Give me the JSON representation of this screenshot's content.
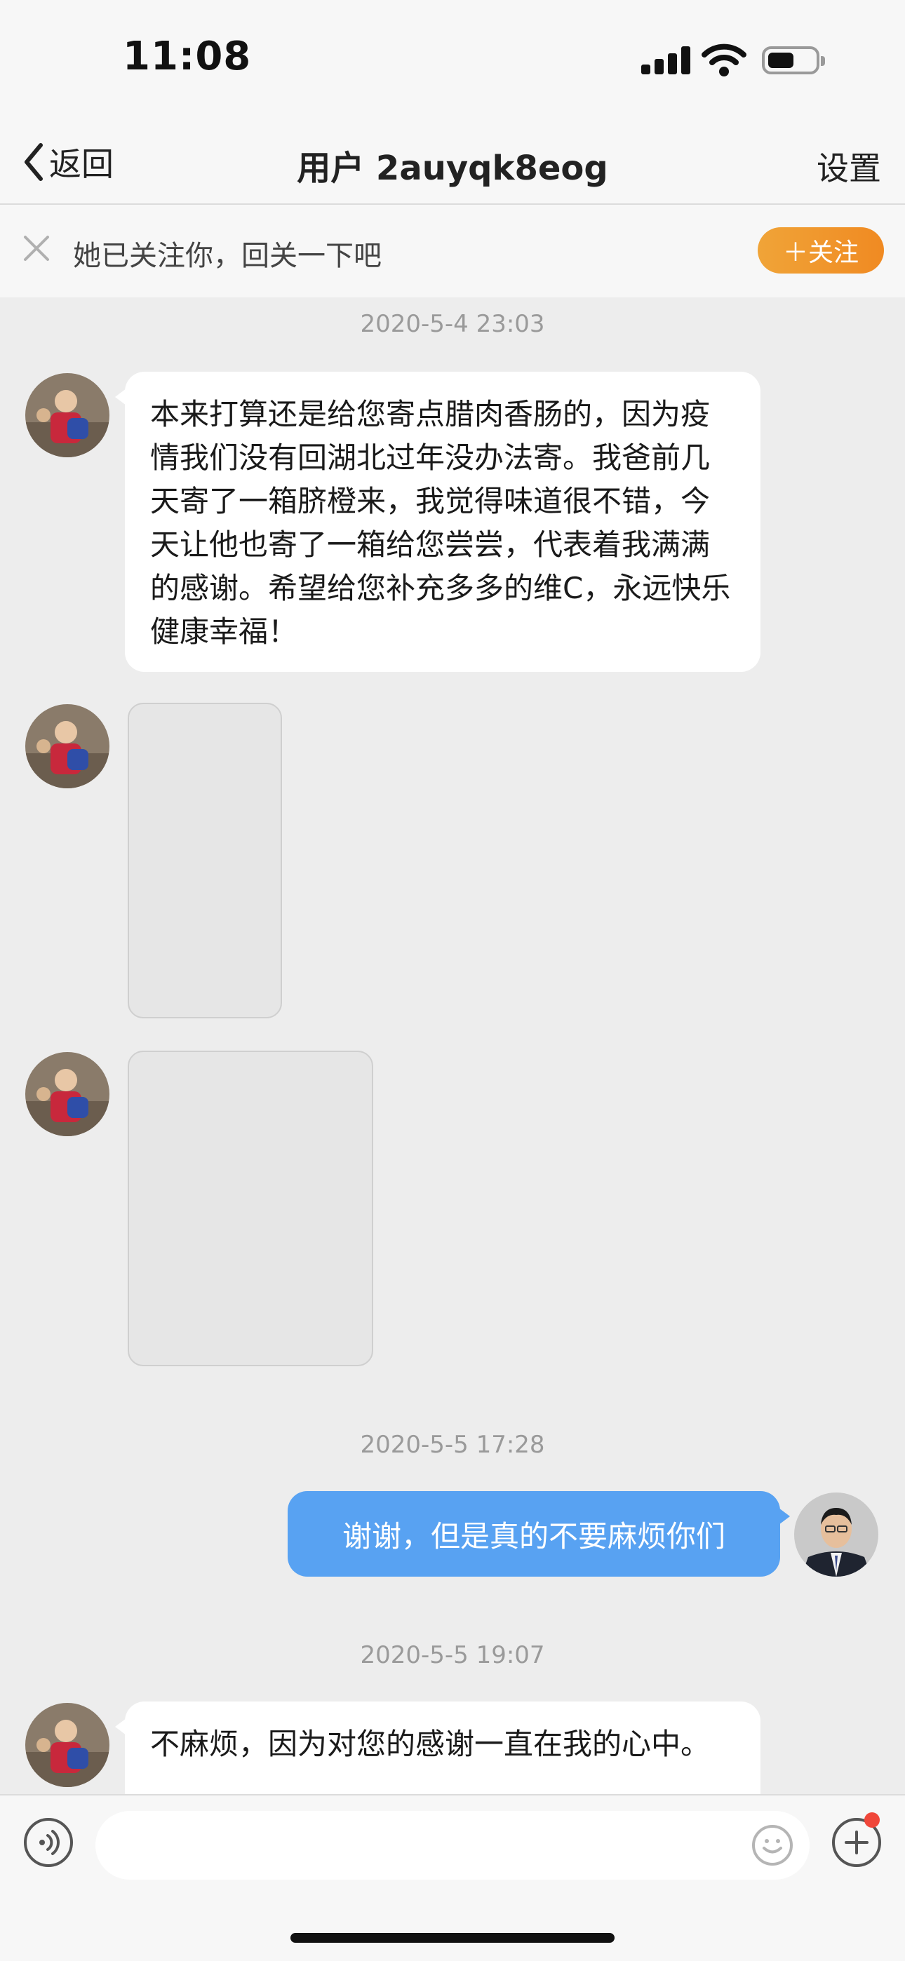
{
  "status_bar": {
    "time": "11:08"
  },
  "nav": {
    "back_label": "返回",
    "title": "用户 2auyqk8eog",
    "settings_label": "设置"
  },
  "follow_banner": {
    "text": "她已关注你，回关一下吧",
    "button_label": "＋关注"
  },
  "conversation": {
    "timestamps": [
      "2020-5-4 23:03",
      "2020-5-5 17:28",
      "2020-5-5 19:07"
    ],
    "messages": [
      {
        "from": "other",
        "type": "text",
        "text": "本来打算还是给您寄点腊肉香肠的，因为疫情我们没有回湖北过年没办法寄。我爸前几天寄了一箱脐橙来，我觉得味道很不错，今天让他也寄了一箱给您尝尝，代表着我满满的感谢。希望给您补充多多的维C，永远快乐健康幸福！"
      },
      {
        "from": "other",
        "type": "image"
      },
      {
        "from": "other",
        "type": "image"
      },
      {
        "from": "me",
        "type": "text",
        "text": "谢谢，但是真的不要麻烦你们"
      },
      {
        "from": "other",
        "type": "text",
        "text": "不麻烦，因为对您的感谢一直在我的心中。"
      }
    ]
  },
  "input_bar": {
    "placeholder": ""
  },
  "colors": {
    "accent_blue": "#58a2f2",
    "follow_orange": "#f08a22",
    "background": "#ededed",
    "badge_red": "#f0473a"
  },
  "icons": [
    "chevron-left-icon",
    "close-icon",
    "signal-icon",
    "wifi-icon",
    "battery-icon",
    "voice-icon",
    "emoji-icon",
    "plus-icon"
  ]
}
